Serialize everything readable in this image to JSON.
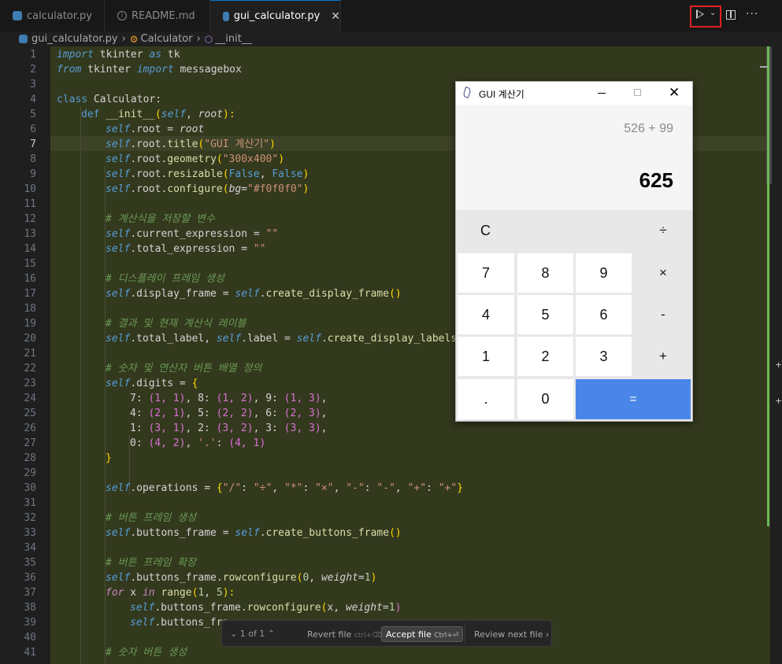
{
  "tabs": [
    {
      "label": "calculator.py",
      "icon": "python-icon",
      "active": false
    },
    {
      "label": "README.md",
      "icon": "info-icon",
      "active": false
    },
    {
      "label": "gui_calculator.py",
      "icon": "python-icon",
      "active": true,
      "close": "✕"
    }
  ],
  "breadcrumb": {
    "file": "gui_calculator.py",
    "class": "Calculator",
    "method": "__init__"
  },
  "review_bar": {
    "counter": "1 of 1",
    "revert_label": "Revert file",
    "revert_shortcut": "ctrl+⌫",
    "accept_label": "Accept file",
    "accept_shortcut": "Ctrl+⏎",
    "next_label": "Review next file"
  },
  "tk_window": {
    "title": "GUI 계산기",
    "expression": "526 + 99",
    "result": "625",
    "buttons": {
      "clear": "C",
      "divide": "÷",
      "multiply": "×",
      "minus": "-",
      "plus": "+",
      "equals": "=",
      "d7": "7",
      "d8": "8",
      "d9": "9",
      "d4": "4",
      "d5": "5",
      "d6": "6",
      "d1": "1",
      "d2": "2",
      "d3": "3",
      "d0": "0",
      "dot": "."
    }
  },
  "code": {
    "current_line": 7,
    "line_numbers": [
      "1",
      "2",
      "3",
      "4",
      "5",
      "6",
      "7",
      "8",
      "9",
      "10",
      "11",
      "12",
      "13",
      "14",
      "15",
      "16",
      "17",
      "18",
      "19",
      "20",
      "21",
      "22",
      "23",
      "24",
      "25",
      "26",
      "27",
      "28",
      "29",
      "30",
      "31",
      "32",
      "33",
      "34",
      "35",
      "36",
      "37",
      "38",
      "39",
      "40",
      "41"
    ],
    "tokens": {
      "l1": [
        "import",
        " tkinter ",
        "as",
        " tk"
      ],
      "l2": [
        "from",
        " tkinter ",
        "import",
        " messagebox"
      ],
      "l4": [
        "class",
        " Calculator:"
      ],
      "l5": [
        "def",
        " ",
        "__init__",
        "(",
        "self",
        ", ",
        "root",
        "):"
      ],
      "l6": [
        "self",
        ".root = ",
        "root"
      ],
      "l7": [
        "self",
        ".root.",
        "title",
        "(",
        "\"GUI 계산기\"",
        ")"
      ],
      "l8": [
        "self",
        ".root.",
        "geometry",
        "(",
        "\"300x400\"",
        ")"
      ],
      "l9": [
        "self",
        ".root.",
        "resizable",
        "(",
        "False",
        ", ",
        "False",
        ")"
      ],
      "l10": [
        "self",
        ".root.",
        "configure",
        "(",
        "bg",
        "=",
        "\"#f0f0f0\"",
        ")"
      ],
      "l12": "# 계산식을 저장할 변수",
      "l13": [
        "self",
        ".current_expression = ",
        "\"\""
      ],
      "l14": [
        "self",
        ".total_expression = ",
        "\"\""
      ],
      "l16": "# 디스플레이 프레임 생성",
      "l17": [
        "self",
        ".display_frame = ",
        "self",
        ".",
        "create_display_frame",
        "()"
      ],
      "l19": "# 결과 및 현재 계산식 레이블",
      "l20": [
        "self",
        ".total_label, ",
        "self",
        ".label = ",
        "self",
        ".",
        "create_display_labels",
        "("
      ],
      "l22": "# 숫자 및 연산자 버튼 배열 정의",
      "l23": [
        "self",
        ".digits = ",
        "{"
      ],
      "l24": [
        "7: ",
        "(1, 1)",
        ", 8: ",
        "(1, 2)",
        ", 9: ",
        "(1, 3)",
        ","
      ],
      "l25": [
        "4: ",
        "(2, 1)",
        ", 5: ",
        "(2, 2)",
        ", 6: ",
        "(2, 3)",
        ","
      ],
      "l26": [
        "1: ",
        "(3, 1)",
        ", 2: ",
        "(3, 2)",
        ", 3: ",
        "(3, 3)",
        ","
      ],
      "l27": [
        "0: ",
        "(4, 2)",
        ", ",
        "'.'",
        ": ",
        "(4, 1)"
      ],
      "l28": [
        "}"
      ],
      "l30": [
        "self",
        ".operations = ",
        "{",
        "\"/\"",
        ": ",
        "\"÷\"",
        ", ",
        "\"*\"",
        ": ",
        "\"×\"",
        ", ",
        "\"-\"",
        ": ",
        "\"-\"",
        ", ",
        "\"+\"",
        ": ",
        "\"+\"",
        "}"
      ],
      "l32": "# 버튼 프레임 생성",
      "l33": [
        "self",
        ".buttons_frame = ",
        "self",
        ".",
        "create_buttons_frame",
        "()"
      ],
      "l35": "# 버튼 프레임 확장",
      "l36": [
        "self",
        ".buttons_frame.",
        "rowconfigure",
        "(",
        "0",
        ", ",
        "weight",
        "=",
        "1",
        ")"
      ],
      "l37": [
        "for",
        " x ",
        "in",
        " ",
        "range",
        "(",
        "1",
        ", ",
        "5",
        "):"
      ],
      "l38": [
        "self",
        ".buttons_frame.",
        "rowconfigure",
        "(",
        "x",
        ", ",
        "weight",
        "=",
        "1",
        ")"
      ],
      "l39": [
        "self",
        ".buttons_fra"
      ],
      "l41": "# 숫자 버튼 생성"
    }
  },
  "colors": {
    "accent_run_box": "#e02020",
    "equals_button": "#4a86e8",
    "diff_added": "#6cb956"
  }
}
